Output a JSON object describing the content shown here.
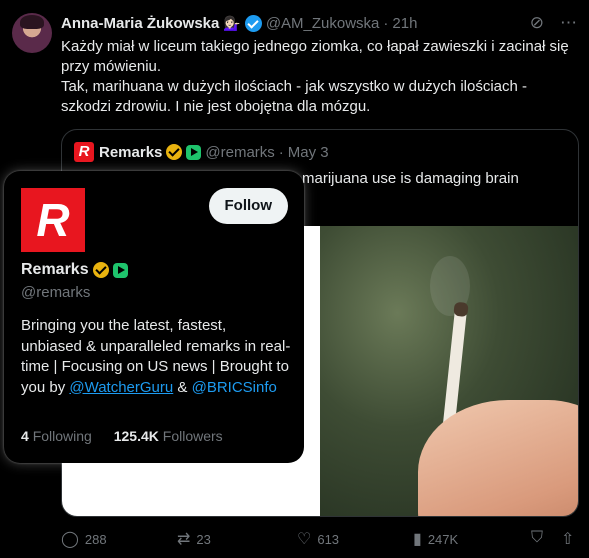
{
  "tweet": {
    "author_name": "Anna-Maria Żukowska",
    "author_emoji": "💁🏻‍♀️",
    "handle": "@AM_Zukowska",
    "separator": "·",
    "time": "21h",
    "paragraph1": "Każdy miał w liceum takiego jednego ziomka, co łapał zawieszki i zacinał się przy mówieniu.",
    "paragraph2": "Tak, marihuana w dużych ilościach - jak wszystko w dużych ilościach - szkodzi zdrowiu. I nie jest obojętna dla mózgu."
  },
  "quote": {
    "logo_letter": "R",
    "name": "Remarks",
    "handle": "@remarks",
    "separator": "·",
    "date": "May 3",
    "text_visible": "marijuana use is damaging brain"
  },
  "hover_card": {
    "logo_letter": "R",
    "follow_label": "Follow",
    "name": "Remarks",
    "handle": "@remarks",
    "bio_text": "Bringing you the latest, fastest, unbiased & unparalleled remarks in real-time | Focusing on US news | Brought to you by ",
    "bio_link1": "@WatcherGuru",
    "bio_amp": " & ",
    "bio_link2": "@BRICSinfo",
    "following_count": "4",
    "following_label": "Following",
    "followers_count": "125.4K",
    "followers_label": "Followers"
  },
  "actions": {
    "replies": "288",
    "reposts": "23",
    "likes": "613",
    "views": "247K"
  },
  "colors": {
    "background": "#000000",
    "text": "#e7e9ea",
    "muted": "#71767b",
    "link": "#1d9bf0",
    "brand_red": "#e8161f"
  },
  "icons": [
    "verified-badge-icon",
    "grok-icon",
    "more-icon",
    "gold-badge-icon",
    "green-play-badge-icon",
    "reply-icon",
    "repost-icon",
    "like-icon",
    "views-icon",
    "bookmark-icon",
    "share-icon"
  ]
}
